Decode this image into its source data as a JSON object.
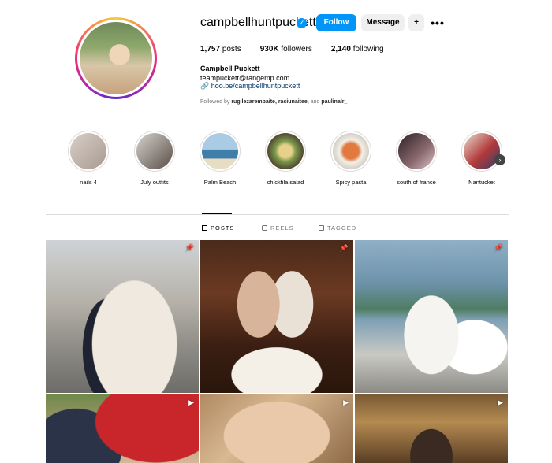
{
  "profile": {
    "username": "campbellhuntpuckett",
    "follow_label": "Follow",
    "message_label": "Message",
    "posts_count": "1,757",
    "posts_label": "posts",
    "followers_count": "930K",
    "followers_label": "followers",
    "following_count": "2,140",
    "following_label": "following",
    "full_name": "Campbell Puckett",
    "email": "teampuckett@rangemp.com",
    "link": "hoo.be/campbellhuntpuckett",
    "followed_by_prefix": "Followed by",
    "followed_by_names": "rugilezarembaite, raciunaitee,",
    "followed_by_and": "and",
    "followed_by_last": "paulinalr_"
  },
  "highlights": [
    {
      "label": "nails 4",
      "color": "#b9aca3"
    },
    {
      "label": "July outfits",
      "color": "#7c7069"
    },
    {
      "label": "Palm Beach",
      "color": "#6a9bb8"
    },
    {
      "label": "chickfila salad",
      "color": "#8a7a4f"
    },
    {
      "label": "Spicy pasta",
      "color": "#c98a5a"
    },
    {
      "label": "south of france",
      "color": "#4b3a3a"
    },
    {
      "label": "Nantucket",
      "color": "#c9b7a6"
    }
  ],
  "tabs": {
    "posts": "POSTS",
    "reels": "REELS",
    "tagged": "TAGGED"
  },
  "icons": {
    "verified": "verified-badge-icon",
    "add_user": "add-user-icon",
    "more": "more-icon",
    "link": "link-icon",
    "pin": "pin-icon",
    "reel": "reel-icon"
  },
  "colors": {
    "accent": "#0095f6",
    "link": "#00376b"
  }
}
